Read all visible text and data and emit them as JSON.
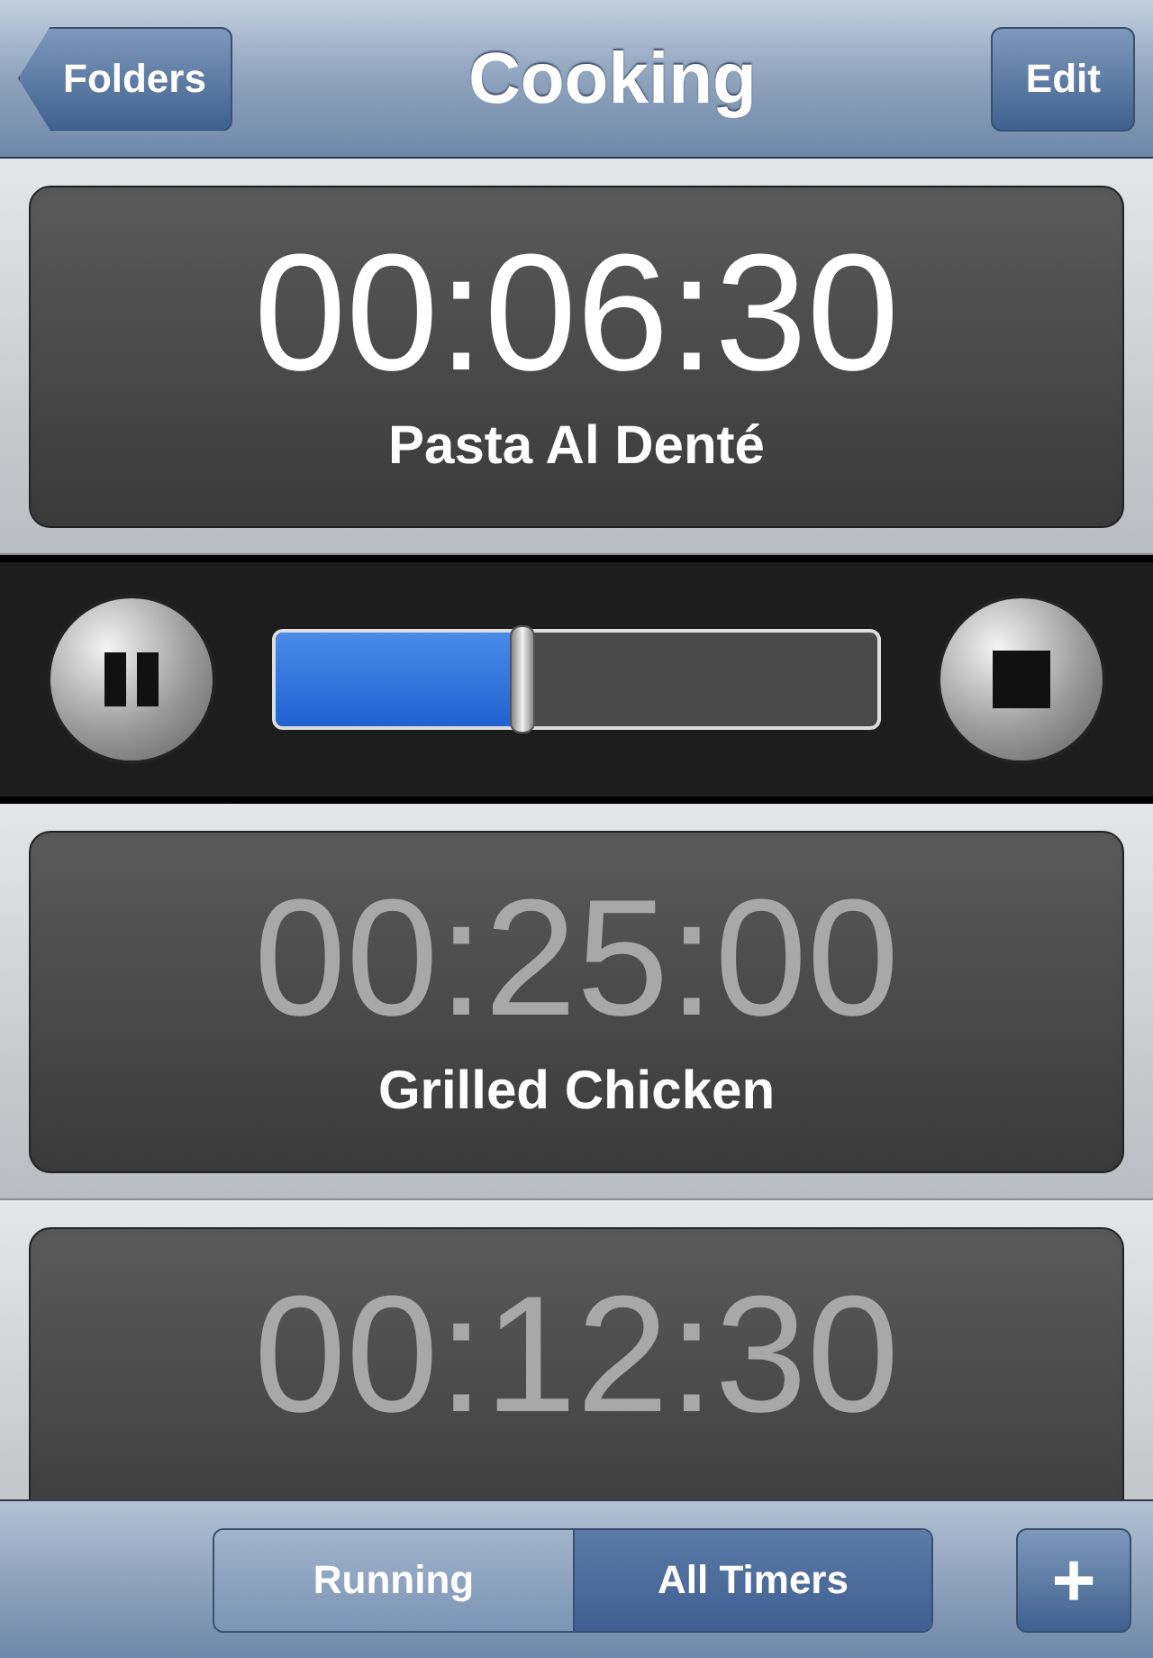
{
  "nav_bar": {
    "back_button": "Folders",
    "title": "Cooking",
    "edit_button": "Edit"
  },
  "timers": [
    {
      "time": "00:06:30",
      "name": "Pasta Al Denté",
      "running": true,
      "level": 0.41
    },
    {
      "time": "00:25:00",
      "name": "Grilled Chicken",
      "running": false
    },
    {
      "time": "00:12:30",
      "running": false
    }
  ],
  "bottom_bar": {
    "segments": [
      {
        "label": "Running",
        "selected": false
      },
      {
        "label": "All Timers",
        "selected": true
      }
    ],
    "add_button": "+"
  }
}
